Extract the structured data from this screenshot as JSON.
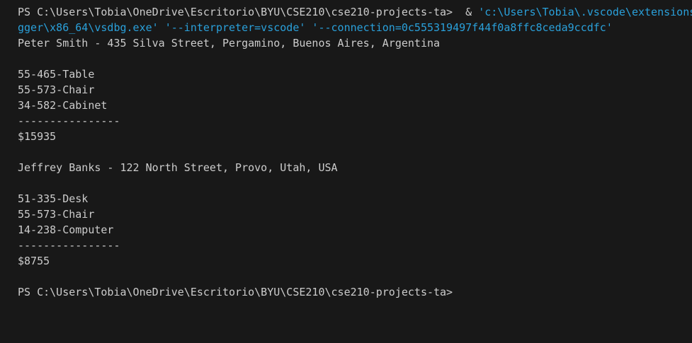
{
  "terminal": {
    "prompt": "PS C:\\Users\\Tobia\\OneDrive\\Escritorio\\BYU\\CSE210\\cse210-projects-ta>",
    "command_operator": "  & ",
    "command_line1_string": "'c:\\Users\\Tobia\\.vscode\\extensions",
    "command_line2": "gger\\x86_64\\vsdbg.exe' '--interpreter=vscode' '--connection=0c555319497f44f0a8ffc8ceda9ccdfc'",
    "output": [
      "Peter Smith - 435 Silva Street, Pergamino, Buenos Aires, Argentina",
      "",
      "55-465-Table",
      "55-573-Chair",
      "34-582-Cabinet",
      "----------------",
      "$15935",
      "",
      "Jeffrey Banks - 122 North Street, Provo, Utah, USA",
      "",
      "51-335-Desk",
      "55-573-Chair",
      "14-238-Computer",
      "----------------",
      "$8755",
      ""
    ],
    "final_prompt": "PS C:\\Users\\Tobia\\OneDrive\\Escritorio\\BYU\\CSE210\\cse210-projects-ta>",
    "colors": {
      "background": "#181818",
      "text": "#cccccc",
      "string": "#2aa0da"
    }
  }
}
